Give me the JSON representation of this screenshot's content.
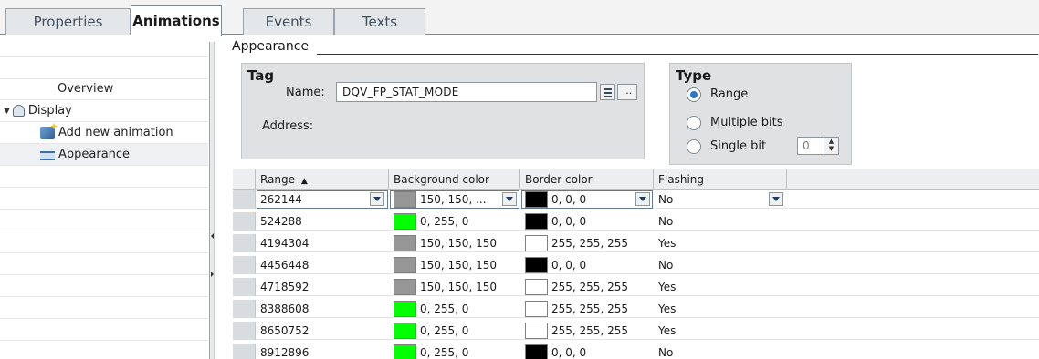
{
  "tabs": [
    {
      "label": "Properties"
    },
    {
      "label": "Animations"
    },
    {
      "label": "Events"
    },
    {
      "label": "Texts"
    }
  ],
  "tree": {
    "overview": "Overview",
    "display": "Display",
    "add_new": "Add new animation",
    "appearance": "Appearance"
  },
  "group_title": "Appearance",
  "tag": {
    "header": "Tag",
    "name_label": "Name:",
    "name_value": "DQV_FP_STAT_MODE",
    "address_label": "Address:",
    "more_button": "..."
  },
  "type": {
    "header": "Type",
    "options": [
      {
        "label": "Range",
        "selected": true
      },
      {
        "label": "Multiple bits",
        "selected": false
      },
      {
        "label": "Single bit",
        "selected": false
      }
    ],
    "single_bit_value": "0"
  },
  "grid": {
    "columns": [
      "Range",
      "Background color",
      "Border color",
      "Flashing"
    ],
    "sort_indicator": "▲",
    "rows": [
      {
        "range": "262144",
        "bg_text": "150, 150, ...",
        "bg_color": "#969696",
        "border_text": "0, 0, 0",
        "border_color": "#000000",
        "flashing": "No"
      },
      {
        "range": "524288",
        "bg_text": "0, 255, 0",
        "bg_color": "#00ff00",
        "border_text": "0, 0, 0",
        "border_color": "#000000",
        "flashing": "No"
      },
      {
        "range": "4194304",
        "bg_text": "150, 150, 150",
        "bg_color": "#969696",
        "border_text": "255, 255, 255",
        "border_color": "#ffffff",
        "flashing": "Yes"
      },
      {
        "range": "4456448",
        "bg_text": "150, 150, 150",
        "bg_color": "#969696",
        "border_text": "0, 0, 0",
        "border_color": "#000000",
        "flashing": "No"
      },
      {
        "range": "4718592",
        "bg_text": "150, 150, 150",
        "bg_color": "#969696",
        "border_text": "255, 255, 255",
        "border_color": "#ffffff",
        "flashing": "Yes"
      },
      {
        "range": "8388608",
        "bg_text": "0, 255, 0",
        "bg_color": "#00ff00",
        "border_text": "255, 255, 255",
        "border_color": "#ffffff",
        "flashing": "Yes"
      },
      {
        "range": "8650752",
        "bg_text": "0, 255, 0",
        "bg_color": "#00ff00",
        "border_text": "255, 255, 255",
        "border_color": "#ffffff",
        "flashing": "Yes"
      },
      {
        "range": "8912896",
        "bg_text": "0, 255, 0",
        "bg_color": "#00ff00",
        "border_text": "0, 0, 0",
        "border_color": "#000000",
        "flashing": "No"
      }
    ]
  }
}
